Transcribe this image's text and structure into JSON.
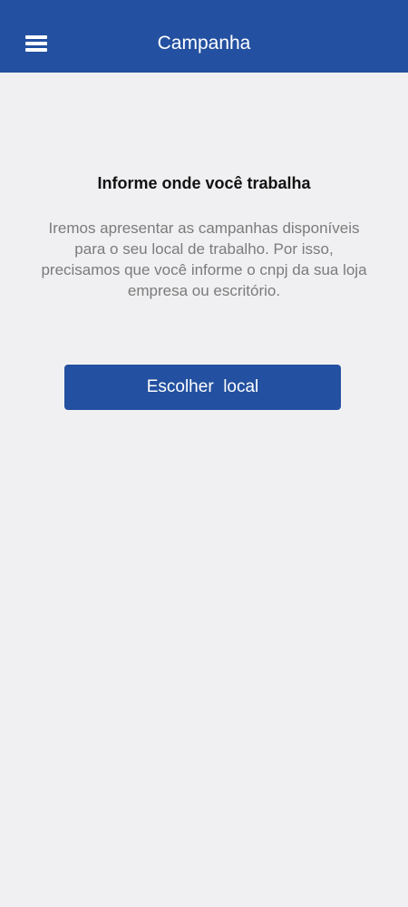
{
  "header": {
    "title": "Campanha",
    "menu_icon": "menu-icon",
    "background_color": "#2350a0"
  },
  "main": {
    "heading": "Informe onde você trabalha",
    "description": "Iremos apresentar as campanhas disponíveis para o seu local de trabalho. Por isso, precisamos que você informe o cnpj da sua loja empresa ou escritório.",
    "button_label": "Escolher  local"
  },
  "colors": {
    "accent": "#2350a0",
    "background": "#f0f0f2",
    "text_primary": "#111111",
    "text_secondary": "#7b7b7b"
  }
}
